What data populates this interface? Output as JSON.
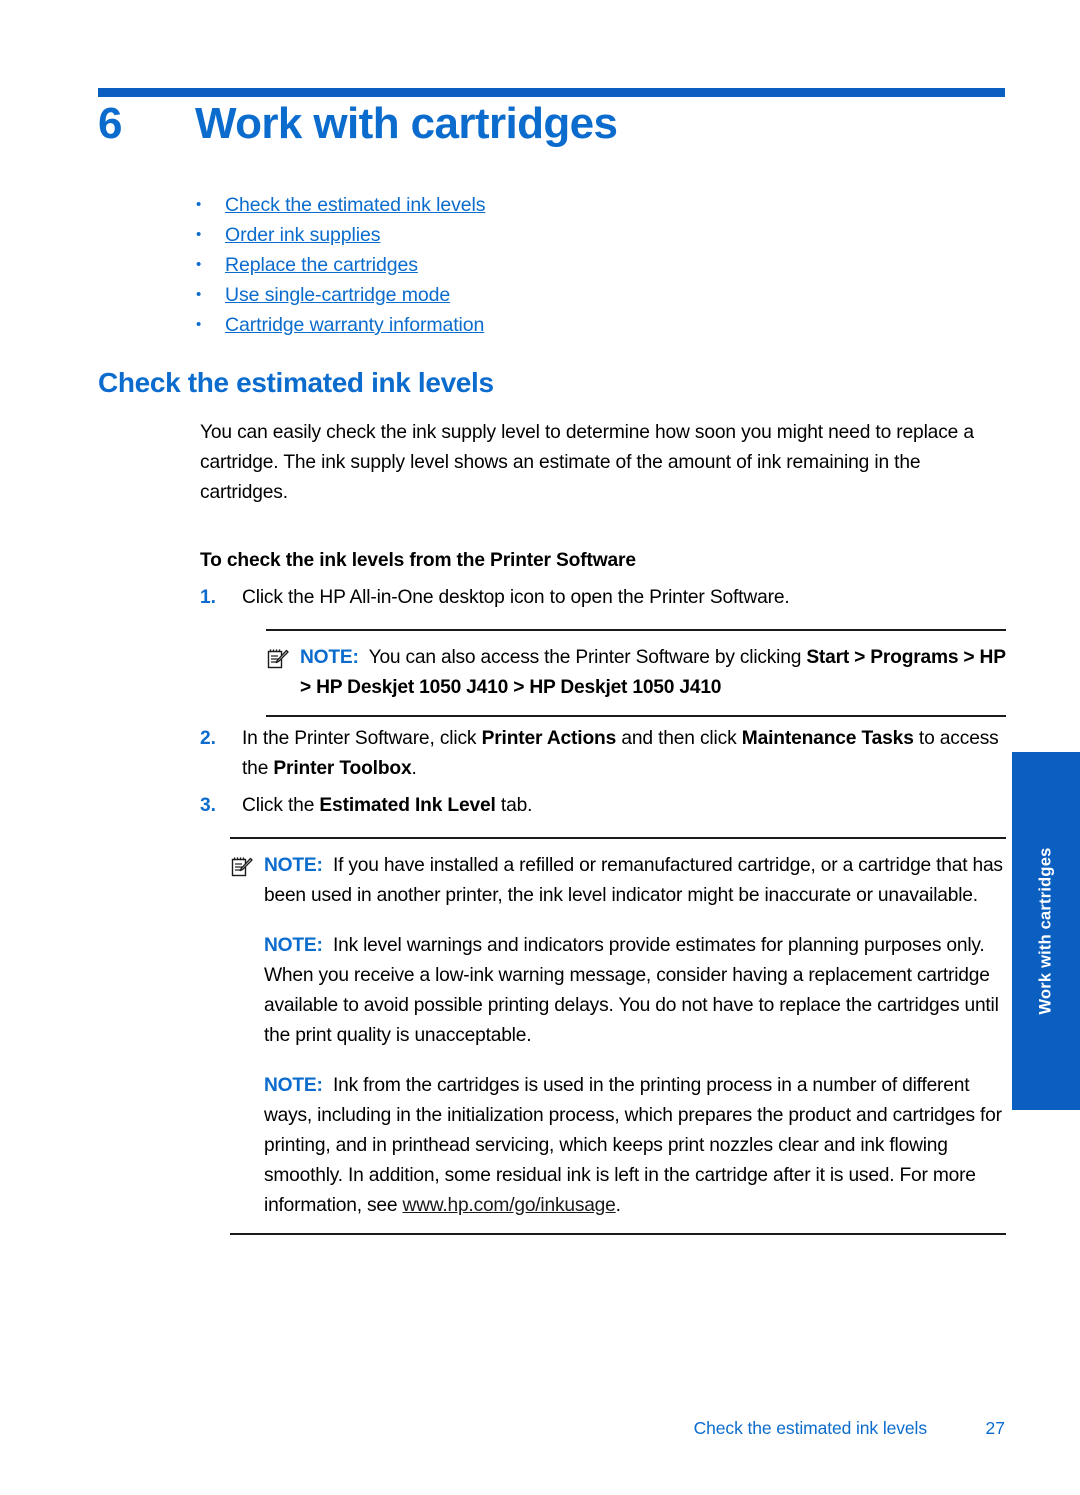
{
  "colors": {
    "accent_blue": "#0b6ccd",
    "rule_blue": "#0b5fc0",
    "text_black": "#000000"
  },
  "chapter": {
    "number": "6",
    "title": "Work with cartridges"
  },
  "toc": {
    "bullet": "•",
    "items": [
      {
        "label": "Check the estimated ink levels"
      },
      {
        "label": "Order ink supplies"
      },
      {
        "label": "Replace the cartridges"
      },
      {
        "label": "Use single-cartridge mode"
      },
      {
        "label": "Cartridge warranty information"
      }
    ]
  },
  "section": {
    "heading": "Check the estimated ink levels",
    "intro": "You can easily check the ink supply level to determine how soon you might need to replace a cartridge. The ink supply level shows an estimate of the amount of ink remaining in the cartridges.",
    "procedure_heading": "To check the ink levels from the Printer Software"
  },
  "steps": [
    {
      "number": "1.",
      "text_parts": [
        {
          "text": "Click the HP All-in-One desktop icon to open the Printer Software.",
          "bold": false
        }
      ]
    },
    {
      "number": "2.",
      "text_parts": [
        {
          "text": "In the Printer Software, click ",
          "bold": false
        },
        {
          "text": "Printer Actions",
          "bold": true
        },
        {
          "text": " and then click ",
          "bold": false
        },
        {
          "text": "Maintenance Tasks",
          "bold": true
        },
        {
          "text": " to access the ",
          "bold": false
        },
        {
          "text": "Printer Toolbox",
          "bold": true
        },
        {
          "text": ".",
          "bold": false
        }
      ]
    },
    {
      "number": "3.",
      "text_parts": [
        {
          "text": "Click the ",
          "bold": false
        },
        {
          "text": "Estimated Ink Level",
          "bold": true
        },
        {
          "text": " tab.",
          "bold": false
        }
      ]
    }
  ],
  "note_label": "NOTE:",
  "note_icon_name": "note-pencil-icon",
  "note_after_step1": {
    "has_icon": true,
    "parts": [
      {
        "text": "You can also access the Printer Software by clicking ",
        "bold": false
      },
      {
        "text": "Start > Programs > HP > HP Deskjet 1050 J410 > HP Deskjet 1050 J410",
        "bold": true
      }
    ]
  },
  "notes_block": [
    {
      "has_icon": true,
      "parts": [
        {
          "text": "If you have installed a refilled or remanufactured cartridge, or a cartridge that has been used in another printer, the ink level indicator might be inaccurate or unavailable.",
          "bold": false
        }
      ]
    },
    {
      "has_icon": false,
      "parts": [
        {
          "text": "Ink level warnings and indicators provide estimates for planning purposes only. When you receive a low-ink warning message, consider having a replacement cartridge available to avoid possible printing delays. You do not have to replace the cartridges until the print quality is unacceptable.",
          "bold": false
        }
      ]
    },
    {
      "has_icon": false,
      "parts": [
        {
          "text": "Ink from the cartridges is used in the printing process in a number of different ways, including in the initialization process, which prepares the product and cartridges for printing, and in printhead servicing, which keeps print nozzles clear and ink flowing smoothly. In addition, some residual ink is left in the cartridge after it is used. For more information, see ",
          "bold": false
        },
        {
          "text": "www.hp.com/go/inkusage",
          "bold": false,
          "link": true
        },
        {
          "text": ".",
          "bold": false
        }
      ]
    }
  ],
  "side_tab": {
    "label": "Work with cartridges"
  },
  "footer": {
    "title": "Check the estimated ink levels",
    "page": "27"
  }
}
